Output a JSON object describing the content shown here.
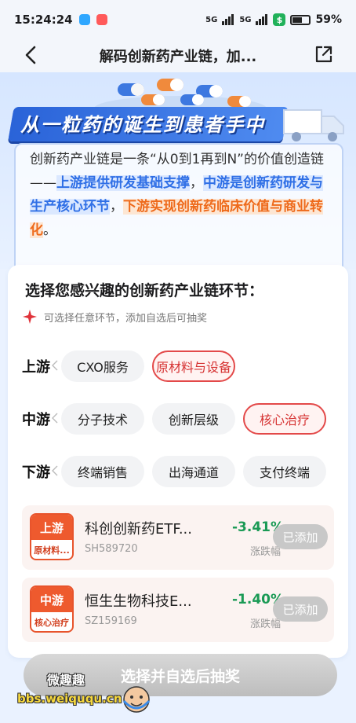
{
  "status_bar": {
    "time": "15:24:24",
    "signal1": "5G",
    "signal2": "5G",
    "battery": "59%"
  },
  "nav": {
    "title": "解码创新药产业链，加..."
  },
  "hero": {
    "title": "从一粒药的诞生到患者手中",
    "desc_part1": "创新药产业链是一条“从0到1再到N”的价值创造链——",
    "desc_hl1": "上游提供研发基础支撑",
    "desc_part2": "，",
    "desc_hl2": "中游是创新药研发与生产核心环节",
    "desc_part3": "，",
    "desc_hl3": "下游实现创新药临床价值与商业转化",
    "desc_part4": "。"
  },
  "selector": {
    "title": "选择您感兴趣的创新药产业链环节：",
    "hint": "可选择任意环节，添加自选后可抽奖",
    "stages": [
      {
        "label": "上游",
        "chips": [
          {
            "label": "CXO服务",
            "selected": false
          },
          {
            "label": "原材料与设备",
            "selected": true
          }
        ]
      },
      {
        "label": "中游",
        "chips": [
          {
            "label": "分子技术",
            "selected": false
          },
          {
            "label": "创新层级",
            "selected": false
          },
          {
            "label": "核心治疗",
            "selected": true
          }
        ]
      },
      {
        "label": "下游",
        "chips": [
          {
            "label": "终端销售",
            "selected": false
          },
          {
            "label": "出海通道",
            "selected": false
          },
          {
            "label": "支付终端",
            "selected": false
          }
        ]
      }
    ]
  },
  "funds": [
    {
      "badge_top": "上游",
      "badge_bottom": "原材料...",
      "name": "科创创新药ETF...",
      "code": "SH589720",
      "change": "-3.41%",
      "change_label": "涨跌幅",
      "button": "已添加"
    },
    {
      "badge_top": "中游",
      "badge_bottom": "核心治疗",
      "name": "恒生生物科技E...",
      "code": "SZ159169",
      "change": "-1.40%",
      "change_label": "涨跌幅",
      "button": "已添加"
    }
  ],
  "cta": {
    "label": "选择并自选后抽奖"
  },
  "watermark": {
    "line1": "微趣趣",
    "line2": "bbs.weiququ.cn"
  },
  "colors": {
    "accent_red": "#e34949",
    "accent_blue": "#2f6fe6",
    "accent_orange": "#ee6a1b",
    "down_green": "#1a9a55"
  }
}
